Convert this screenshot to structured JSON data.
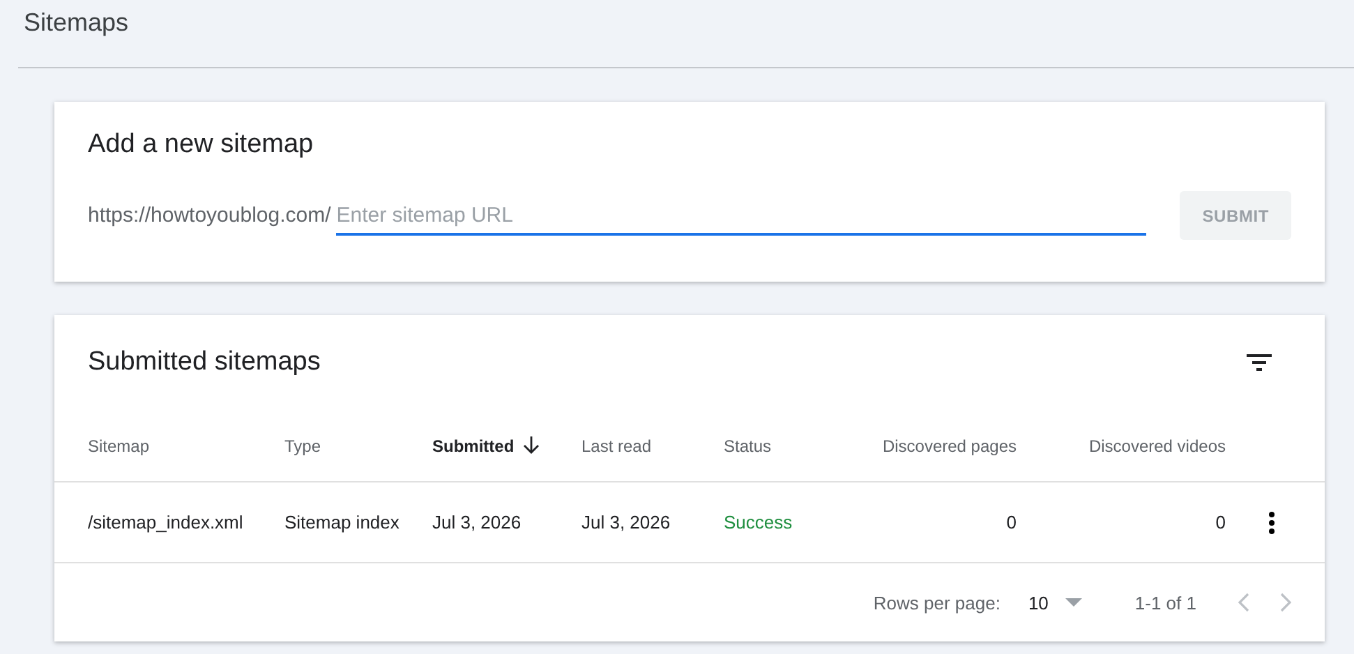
{
  "page_title": "Sitemaps",
  "add_card": {
    "title": "Add a new sitemap",
    "prefix": "https://howtoyoublog.com/",
    "input": {
      "placeholder": "Enter sitemap URL",
      "focused": true
    },
    "submit": {
      "label": "SUBMIT",
      "disabled": true
    }
  },
  "submitted": {
    "title": "Submitted sitemaps",
    "columns": [
      {
        "label": "Sitemap",
        "sorted": false
      },
      {
        "label": "Type",
        "sorted": false
      },
      {
        "label": "Submitted",
        "sorted": true
      },
      {
        "label": "Last read",
        "sorted": false
      },
      {
        "label": "Status",
        "sorted": false
      },
      {
        "label": "Discovered pages",
        "sorted": false
      },
      {
        "label": "Discovered videos",
        "sorted": false
      }
    ],
    "rows": [
      {
        "cells": [
          "/sitemap_index.xml",
          "Sitemap index",
          "Jul 3, 2026",
          "Jul 3, 2026",
          "Success",
          "0",
          "0"
        ],
        "color": "#1e8e3e"
      }
    ],
    "pagination": {
      "rows_label": "Rows per page:",
      "rows_value": "10",
      "range": "1-1 of 1",
      "prev_disabled": true,
      "next_disabled": true
    }
  }
}
